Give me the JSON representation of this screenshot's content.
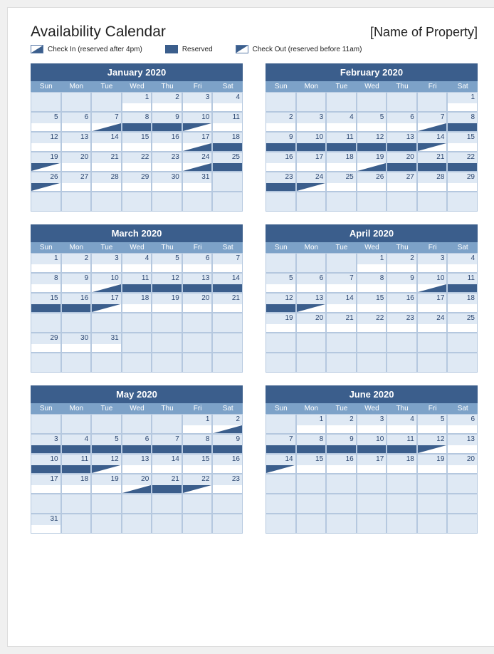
{
  "header": {
    "title": "Availability Calendar",
    "property": "[Name of Property]"
  },
  "legend": {
    "checkin": "Check In (reserved after 4pm)",
    "reserved": "Reserved",
    "checkout": "Check Out (reserved before 11am)"
  },
  "dow": [
    "Sun",
    "Mon",
    "Tue",
    "Wed",
    "Thu",
    "Fri",
    "Sat"
  ],
  "months": [
    {
      "title": "January 2020",
      "weeks": [
        [
          {
            "d": null
          },
          {
            "d": null
          },
          {
            "d": null
          },
          {
            "d": 1,
            "s": "open"
          },
          {
            "d": 2,
            "s": "open"
          },
          {
            "d": 3,
            "s": "open"
          },
          {
            "d": 4,
            "s": "open"
          }
        ],
        [
          {
            "d": 5,
            "s": "open"
          },
          {
            "d": 6,
            "s": "open"
          },
          {
            "d": 7,
            "s": "checkin"
          },
          {
            "d": 8,
            "s": "reserved"
          },
          {
            "d": 9,
            "s": "reserved"
          },
          {
            "d": 10,
            "s": "checkout"
          },
          {
            "d": 11,
            "s": "open"
          }
        ],
        [
          {
            "d": 12,
            "s": "open"
          },
          {
            "d": 13,
            "s": "open"
          },
          {
            "d": 14,
            "s": "open"
          },
          {
            "d": 15,
            "s": "open"
          },
          {
            "d": 16,
            "s": "open"
          },
          {
            "d": 17,
            "s": "checkin"
          },
          {
            "d": 18,
            "s": "reserved"
          }
        ],
        [
          {
            "d": 19,
            "s": "checkout"
          },
          {
            "d": 20,
            "s": "open"
          },
          {
            "d": 21,
            "s": "open"
          },
          {
            "d": 22,
            "s": "open"
          },
          {
            "d": 23,
            "s": "open"
          },
          {
            "d": 24,
            "s": "checkin"
          },
          {
            "d": 25,
            "s": "reserved"
          }
        ],
        [
          {
            "d": 26,
            "s": "checkout"
          },
          {
            "d": 27,
            "s": "open"
          },
          {
            "d": 28,
            "s": "open"
          },
          {
            "d": 29,
            "s": "open"
          },
          {
            "d": 30,
            "s": "open"
          },
          {
            "d": 31,
            "s": "open"
          },
          {
            "d": null
          }
        ],
        [
          {
            "d": null
          },
          {
            "d": null
          },
          {
            "d": null
          },
          {
            "d": null
          },
          {
            "d": null
          },
          {
            "d": null
          },
          {
            "d": null
          }
        ]
      ]
    },
    {
      "title": "February 2020",
      "weeks": [
        [
          {
            "d": null
          },
          {
            "d": null
          },
          {
            "d": null
          },
          {
            "d": null
          },
          {
            "d": null
          },
          {
            "d": null
          },
          {
            "d": 1,
            "s": "open"
          }
        ],
        [
          {
            "d": 2,
            "s": "open"
          },
          {
            "d": 3,
            "s": "open"
          },
          {
            "d": 4,
            "s": "open"
          },
          {
            "d": 5,
            "s": "open"
          },
          {
            "d": 6,
            "s": "open"
          },
          {
            "d": 7,
            "s": "checkin"
          },
          {
            "d": 8,
            "s": "reserved"
          }
        ],
        [
          {
            "d": 9,
            "s": "reserved"
          },
          {
            "d": 10,
            "s": "reserved"
          },
          {
            "d": 11,
            "s": "reserved"
          },
          {
            "d": 12,
            "s": "reserved"
          },
          {
            "d": 13,
            "s": "reserved"
          },
          {
            "d": 14,
            "s": "checkout"
          },
          {
            "d": 15,
            "s": "open"
          }
        ],
        [
          {
            "d": 16,
            "s": "open"
          },
          {
            "d": 17,
            "s": "open"
          },
          {
            "d": 18,
            "s": "open"
          },
          {
            "d": 19,
            "s": "checkin"
          },
          {
            "d": 20,
            "s": "reserved"
          },
          {
            "d": 21,
            "s": "reserved"
          },
          {
            "d": 22,
            "s": "reserved"
          }
        ],
        [
          {
            "d": 23,
            "s": "reserved"
          },
          {
            "d": 24,
            "s": "checkout"
          },
          {
            "d": 25,
            "s": "open"
          },
          {
            "d": 26,
            "s": "open"
          },
          {
            "d": 27,
            "s": "open"
          },
          {
            "d": 28,
            "s": "open"
          },
          {
            "d": 29,
            "s": "open"
          }
        ],
        [
          {
            "d": null
          },
          {
            "d": null
          },
          {
            "d": null
          },
          {
            "d": null
          },
          {
            "d": null
          },
          {
            "d": null
          },
          {
            "d": null
          }
        ]
      ]
    },
    {
      "title": "March 2020",
      "weeks": [
        [
          {
            "d": 1,
            "s": "open"
          },
          {
            "d": 2,
            "s": "open"
          },
          {
            "d": 3,
            "s": "open"
          },
          {
            "d": 4,
            "s": "open"
          },
          {
            "d": 5,
            "s": "open"
          },
          {
            "d": 6,
            "s": "open"
          },
          {
            "d": 7,
            "s": "open"
          }
        ],
        [
          {
            "d": 8,
            "s": "open"
          },
          {
            "d": 9,
            "s": "open"
          },
          {
            "d": 10,
            "s": "checkin"
          },
          {
            "d": 11,
            "s": "reserved"
          },
          {
            "d": 12,
            "s": "reserved"
          },
          {
            "d": 13,
            "s": "reserved"
          },
          {
            "d": 14,
            "s": "reserved"
          }
        ],
        [
          {
            "d": 15,
            "s": "reserved"
          },
          {
            "d": 16,
            "s": "reserved"
          },
          {
            "d": 17,
            "s": "checkout"
          },
          {
            "d": 18,
            "s": "open"
          },
          {
            "d": 19,
            "s": "open"
          },
          {
            "d": 20,
            "s": "open"
          },
          {
            "d": 21,
            "s": "open"
          }
        ],
        [
          {
            "d": null
          },
          {
            "d": null
          },
          {
            "d": null
          },
          {
            "d": null
          },
          {
            "d": null
          },
          {
            "d": null
          },
          {
            "d": null
          }
        ],
        [
          {
            "d": 29,
            "s": "open"
          },
          {
            "d": 30,
            "s": "open"
          },
          {
            "d": 31,
            "s": "open"
          },
          {
            "d": null
          },
          {
            "d": null
          },
          {
            "d": null
          },
          {
            "d": null
          }
        ],
        [
          {
            "d": null
          },
          {
            "d": null
          },
          {
            "d": null
          },
          {
            "d": null
          },
          {
            "d": null
          },
          {
            "d": null
          },
          {
            "d": null
          }
        ]
      ]
    },
    {
      "title": "April 2020",
      "weeks": [
        [
          {
            "d": null
          },
          {
            "d": null
          },
          {
            "d": null
          },
          {
            "d": 1,
            "s": "open"
          },
          {
            "d": 2,
            "s": "open"
          },
          {
            "d": 3,
            "s": "open"
          },
          {
            "d": 4,
            "s": "open"
          }
        ],
        [
          {
            "d": 5,
            "s": "open"
          },
          {
            "d": 6,
            "s": "open"
          },
          {
            "d": 7,
            "s": "open"
          },
          {
            "d": 8,
            "s": "open"
          },
          {
            "d": 9,
            "s": "open"
          },
          {
            "d": 10,
            "s": "checkin"
          },
          {
            "d": 11,
            "s": "reserved"
          }
        ],
        [
          {
            "d": 12,
            "s": "reserved"
          },
          {
            "d": 13,
            "s": "checkout"
          },
          {
            "d": 14,
            "s": "open"
          },
          {
            "d": 15,
            "s": "open"
          },
          {
            "d": 16,
            "s": "open"
          },
          {
            "d": 17,
            "s": "open"
          },
          {
            "d": 18,
            "s": "open"
          }
        ],
        [
          {
            "d": 19,
            "s": "open"
          },
          {
            "d": 20,
            "s": "open"
          },
          {
            "d": 21,
            "s": "open"
          },
          {
            "d": 22,
            "s": "open"
          },
          {
            "d": 23,
            "s": "open"
          },
          {
            "d": 24,
            "s": "open"
          },
          {
            "d": 25,
            "s": "open"
          }
        ],
        [
          {
            "d": null
          },
          {
            "d": null
          },
          {
            "d": null
          },
          {
            "d": null
          },
          {
            "d": null
          },
          {
            "d": null
          },
          {
            "d": null
          }
        ],
        [
          {
            "d": null
          },
          {
            "d": null
          },
          {
            "d": null
          },
          {
            "d": null
          },
          {
            "d": null
          },
          {
            "d": null
          },
          {
            "d": null
          }
        ]
      ]
    },
    {
      "title": "May 2020",
      "weeks": [
        [
          {
            "d": null
          },
          {
            "d": null
          },
          {
            "d": null
          },
          {
            "d": null
          },
          {
            "d": null
          },
          {
            "d": 1,
            "s": "open"
          },
          {
            "d": 2,
            "s": "checkin"
          }
        ],
        [
          {
            "d": 3,
            "s": "reserved"
          },
          {
            "d": 4,
            "s": "reserved"
          },
          {
            "d": 5,
            "s": "reserved"
          },
          {
            "d": 6,
            "s": "reserved"
          },
          {
            "d": 7,
            "s": "reserved"
          },
          {
            "d": 8,
            "s": "reserved"
          },
          {
            "d": 9,
            "s": "reserved"
          }
        ],
        [
          {
            "d": 10,
            "s": "reserved"
          },
          {
            "d": 11,
            "s": "reserved"
          },
          {
            "d": 12,
            "s": "checkout"
          },
          {
            "d": 13,
            "s": "open"
          },
          {
            "d": 14,
            "s": "open"
          },
          {
            "d": 15,
            "s": "open"
          },
          {
            "d": 16,
            "s": "open"
          }
        ],
        [
          {
            "d": 17,
            "s": "open"
          },
          {
            "d": 18,
            "s": "open"
          },
          {
            "d": 19,
            "s": "open"
          },
          {
            "d": 20,
            "s": "checkin"
          },
          {
            "d": 21,
            "s": "reserved"
          },
          {
            "d": 22,
            "s": "checkout"
          },
          {
            "d": 23,
            "s": "open"
          }
        ],
        [
          {
            "d": null
          },
          {
            "d": null
          },
          {
            "d": null
          },
          {
            "d": null
          },
          {
            "d": null
          },
          {
            "d": null
          },
          {
            "d": null
          }
        ],
        [
          {
            "d": 31,
            "s": "open"
          },
          {
            "d": null
          },
          {
            "d": null
          },
          {
            "d": null
          },
          {
            "d": null
          },
          {
            "d": null
          },
          {
            "d": null
          }
        ]
      ]
    },
    {
      "title": "June 2020",
      "weeks": [
        [
          {
            "d": null
          },
          {
            "d": 1,
            "s": "open"
          },
          {
            "d": 2,
            "s": "open"
          },
          {
            "d": 3,
            "s": "open"
          },
          {
            "d": 4,
            "s": "open"
          },
          {
            "d": 5,
            "s": "open"
          },
          {
            "d": 6,
            "s": "open"
          }
        ],
        [
          {
            "d": 7,
            "s": "reserved"
          },
          {
            "d": 8,
            "s": "reserved"
          },
          {
            "d": 9,
            "s": "reserved"
          },
          {
            "d": 10,
            "s": "reserved"
          },
          {
            "d": 11,
            "s": "reserved"
          },
          {
            "d": 12,
            "s": "checkout"
          },
          {
            "d": 13,
            "s": "open"
          }
        ],
        [
          {
            "d": 14,
            "s": "checkout"
          },
          {
            "d": 15,
            "s": "open"
          },
          {
            "d": 16,
            "s": "open"
          },
          {
            "d": 17,
            "s": "open"
          },
          {
            "d": 18,
            "s": "open"
          },
          {
            "d": 19,
            "s": "open"
          },
          {
            "d": 20,
            "s": "open"
          }
        ],
        [
          {
            "d": null
          },
          {
            "d": null
          },
          {
            "d": null
          },
          {
            "d": null
          },
          {
            "d": null
          },
          {
            "d": null
          },
          {
            "d": null
          }
        ],
        [
          {
            "d": null
          },
          {
            "d": null
          },
          {
            "d": null
          },
          {
            "d": null
          },
          {
            "d": null
          },
          {
            "d": null
          },
          {
            "d": null
          }
        ],
        [
          {
            "d": null
          },
          {
            "d": null
          },
          {
            "d": null
          },
          {
            "d": null
          },
          {
            "d": null
          },
          {
            "d": null
          },
          {
            "d": null
          }
        ]
      ]
    }
  ]
}
